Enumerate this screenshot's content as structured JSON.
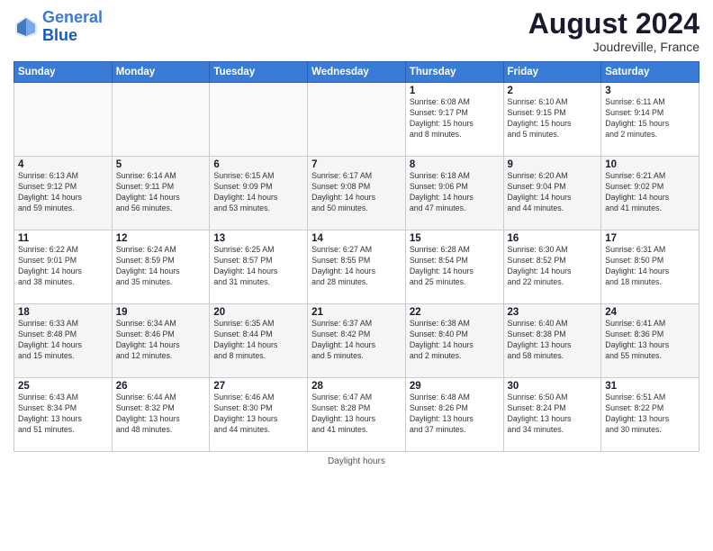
{
  "header": {
    "logo_line1": "General",
    "logo_line2": "Blue",
    "month_title": "August 2024",
    "location": "Joudreville, France"
  },
  "footer": {
    "daylight_label": "Daylight hours"
  },
  "days_of_week": [
    "Sunday",
    "Monday",
    "Tuesday",
    "Wednesday",
    "Thursday",
    "Friday",
    "Saturday"
  ],
  "weeks": [
    [
      {
        "day": "",
        "info": ""
      },
      {
        "day": "",
        "info": ""
      },
      {
        "day": "",
        "info": ""
      },
      {
        "day": "",
        "info": ""
      },
      {
        "day": "1",
        "info": "Sunrise: 6:08 AM\nSunset: 9:17 PM\nDaylight: 15 hours\nand 8 minutes."
      },
      {
        "day": "2",
        "info": "Sunrise: 6:10 AM\nSunset: 9:15 PM\nDaylight: 15 hours\nand 5 minutes."
      },
      {
        "day": "3",
        "info": "Sunrise: 6:11 AM\nSunset: 9:14 PM\nDaylight: 15 hours\nand 2 minutes."
      }
    ],
    [
      {
        "day": "4",
        "info": "Sunrise: 6:13 AM\nSunset: 9:12 PM\nDaylight: 14 hours\nand 59 minutes."
      },
      {
        "day": "5",
        "info": "Sunrise: 6:14 AM\nSunset: 9:11 PM\nDaylight: 14 hours\nand 56 minutes."
      },
      {
        "day": "6",
        "info": "Sunrise: 6:15 AM\nSunset: 9:09 PM\nDaylight: 14 hours\nand 53 minutes."
      },
      {
        "day": "7",
        "info": "Sunrise: 6:17 AM\nSunset: 9:08 PM\nDaylight: 14 hours\nand 50 minutes."
      },
      {
        "day": "8",
        "info": "Sunrise: 6:18 AM\nSunset: 9:06 PM\nDaylight: 14 hours\nand 47 minutes."
      },
      {
        "day": "9",
        "info": "Sunrise: 6:20 AM\nSunset: 9:04 PM\nDaylight: 14 hours\nand 44 minutes."
      },
      {
        "day": "10",
        "info": "Sunrise: 6:21 AM\nSunset: 9:02 PM\nDaylight: 14 hours\nand 41 minutes."
      }
    ],
    [
      {
        "day": "11",
        "info": "Sunrise: 6:22 AM\nSunset: 9:01 PM\nDaylight: 14 hours\nand 38 minutes."
      },
      {
        "day": "12",
        "info": "Sunrise: 6:24 AM\nSunset: 8:59 PM\nDaylight: 14 hours\nand 35 minutes."
      },
      {
        "day": "13",
        "info": "Sunrise: 6:25 AM\nSunset: 8:57 PM\nDaylight: 14 hours\nand 31 minutes."
      },
      {
        "day": "14",
        "info": "Sunrise: 6:27 AM\nSunset: 8:55 PM\nDaylight: 14 hours\nand 28 minutes."
      },
      {
        "day": "15",
        "info": "Sunrise: 6:28 AM\nSunset: 8:54 PM\nDaylight: 14 hours\nand 25 minutes."
      },
      {
        "day": "16",
        "info": "Sunrise: 6:30 AM\nSunset: 8:52 PM\nDaylight: 14 hours\nand 22 minutes."
      },
      {
        "day": "17",
        "info": "Sunrise: 6:31 AM\nSunset: 8:50 PM\nDaylight: 14 hours\nand 18 minutes."
      }
    ],
    [
      {
        "day": "18",
        "info": "Sunrise: 6:33 AM\nSunset: 8:48 PM\nDaylight: 14 hours\nand 15 minutes."
      },
      {
        "day": "19",
        "info": "Sunrise: 6:34 AM\nSunset: 8:46 PM\nDaylight: 14 hours\nand 12 minutes."
      },
      {
        "day": "20",
        "info": "Sunrise: 6:35 AM\nSunset: 8:44 PM\nDaylight: 14 hours\nand 8 minutes."
      },
      {
        "day": "21",
        "info": "Sunrise: 6:37 AM\nSunset: 8:42 PM\nDaylight: 14 hours\nand 5 minutes."
      },
      {
        "day": "22",
        "info": "Sunrise: 6:38 AM\nSunset: 8:40 PM\nDaylight: 14 hours\nand 2 minutes."
      },
      {
        "day": "23",
        "info": "Sunrise: 6:40 AM\nSunset: 8:38 PM\nDaylight: 13 hours\nand 58 minutes."
      },
      {
        "day": "24",
        "info": "Sunrise: 6:41 AM\nSunset: 8:36 PM\nDaylight: 13 hours\nand 55 minutes."
      }
    ],
    [
      {
        "day": "25",
        "info": "Sunrise: 6:43 AM\nSunset: 8:34 PM\nDaylight: 13 hours\nand 51 minutes."
      },
      {
        "day": "26",
        "info": "Sunrise: 6:44 AM\nSunset: 8:32 PM\nDaylight: 13 hours\nand 48 minutes."
      },
      {
        "day": "27",
        "info": "Sunrise: 6:46 AM\nSunset: 8:30 PM\nDaylight: 13 hours\nand 44 minutes."
      },
      {
        "day": "28",
        "info": "Sunrise: 6:47 AM\nSunset: 8:28 PM\nDaylight: 13 hours\nand 41 minutes."
      },
      {
        "day": "29",
        "info": "Sunrise: 6:48 AM\nSunset: 8:26 PM\nDaylight: 13 hours\nand 37 minutes."
      },
      {
        "day": "30",
        "info": "Sunrise: 6:50 AM\nSunset: 8:24 PM\nDaylight: 13 hours\nand 34 minutes."
      },
      {
        "day": "31",
        "info": "Sunrise: 6:51 AM\nSunset: 8:22 PM\nDaylight: 13 hours\nand 30 minutes."
      }
    ]
  ]
}
